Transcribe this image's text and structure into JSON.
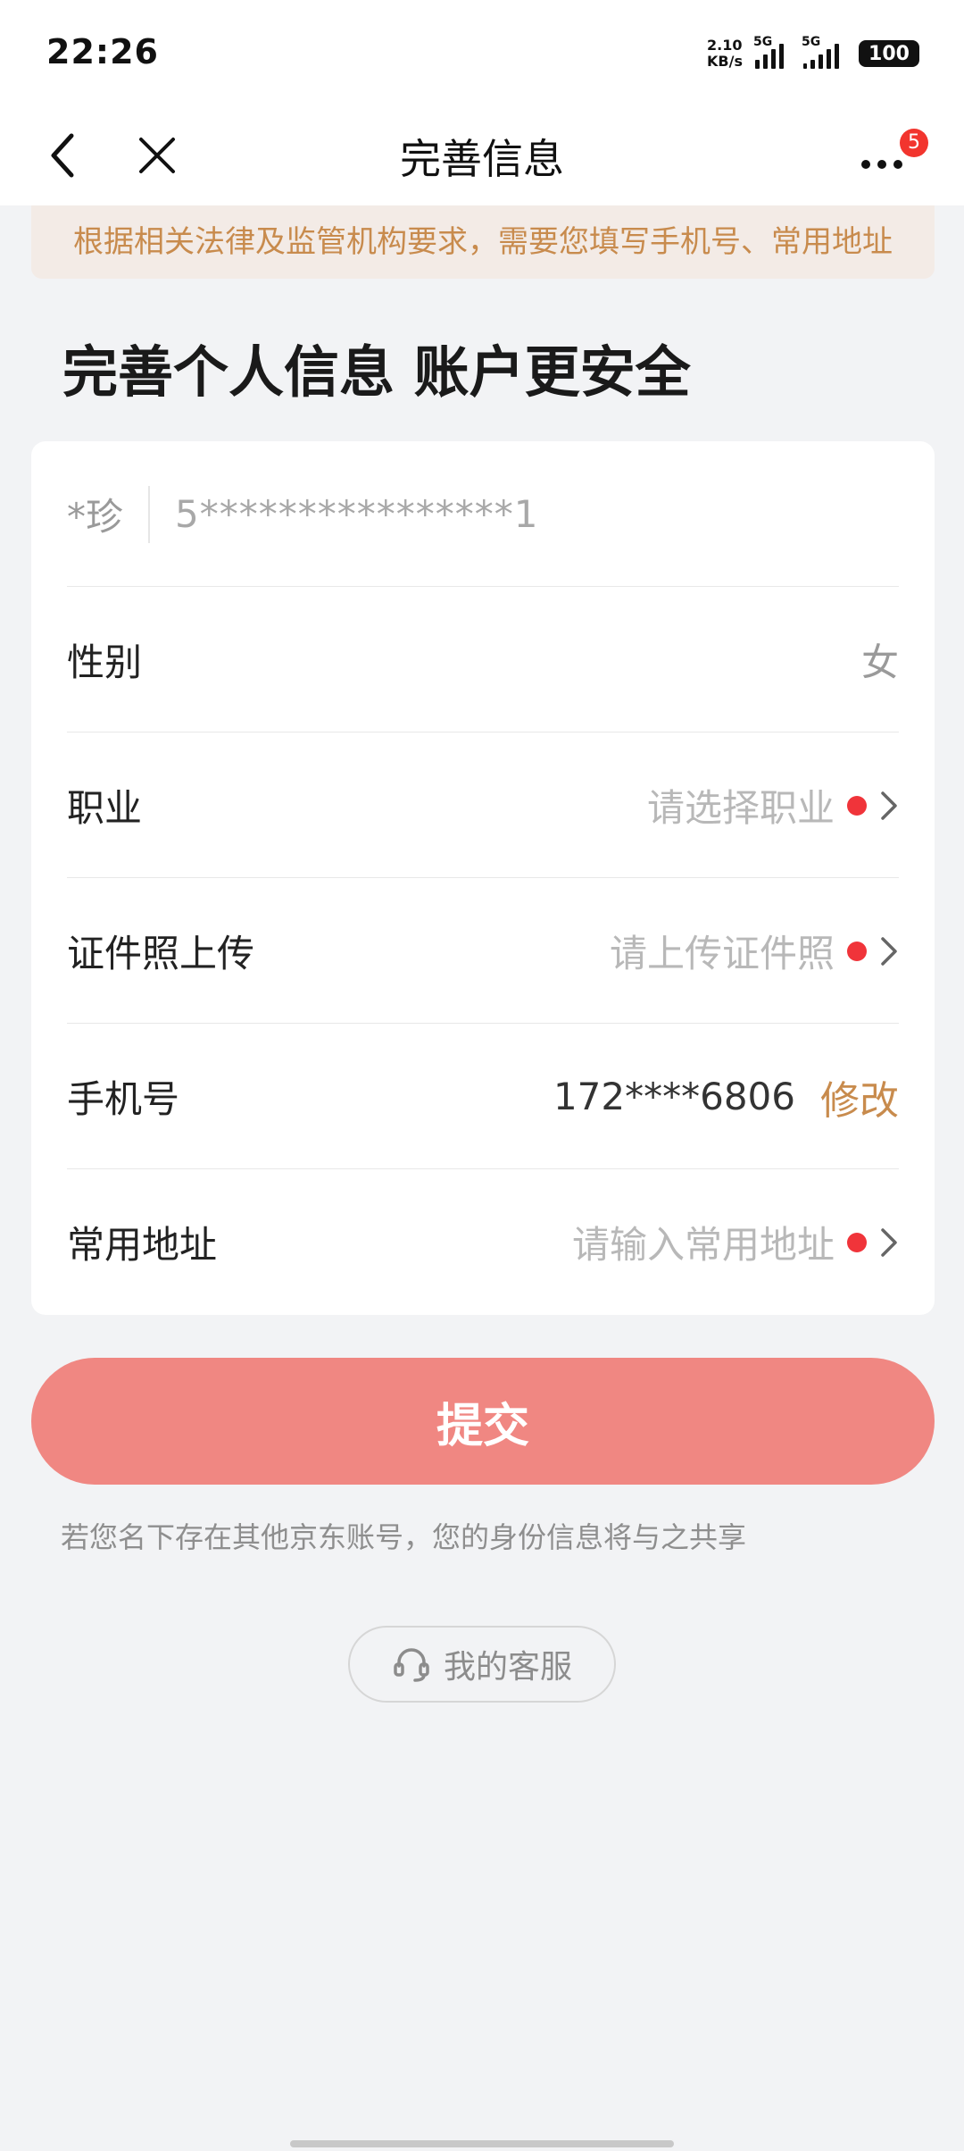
{
  "status_bar": {
    "time": "22:26",
    "net_speed_value": "2.10",
    "net_speed_unit": "KB/s",
    "sim1_tag": "5G",
    "sim2_tag": "5G",
    "battery": "100"
  },
  "nav": {
    "title": "完善信息",
    "more_badge": "5",
    "icons": [
      "back-icon",
      "close-icon",
      "more-icon"
    ]
  },
  "notice": "根据相关法律及监管机构要求，需要您填写手机号、常用地址",
  "heading": "完善个人信息 账户更安全",
  "form": {
    "name_masked": "*珍",
    "id_masked": "5****************1",
    "gender_label": "性别",
    "gender_value": "女",
    "occupation_label": "职业",
    "occupation_placeholder": "请选择职业",
    "id_photo_label": "证件照上传",
    "id_photo_placeholder": "请上传证件照",
    "phone_label": "手机号",
    "phone_value": "172****6806",
    "phone_edit": "修改",
    "address_label": "常用地址",
    "address_placeholder": "请输入常用地址"
  },
  "submit_label": "提交",
  "share_note": "若您名下存在其他京东账号，您的身份信息将与之共享",
  "service_label": "我的客服",
  "colors": {
    "accent_orange": "#c88b4d",
    "submit_bg": "#f08782",
    "required_dot": "#f0343a",
    "badge": "#f2352e"
  }
}
